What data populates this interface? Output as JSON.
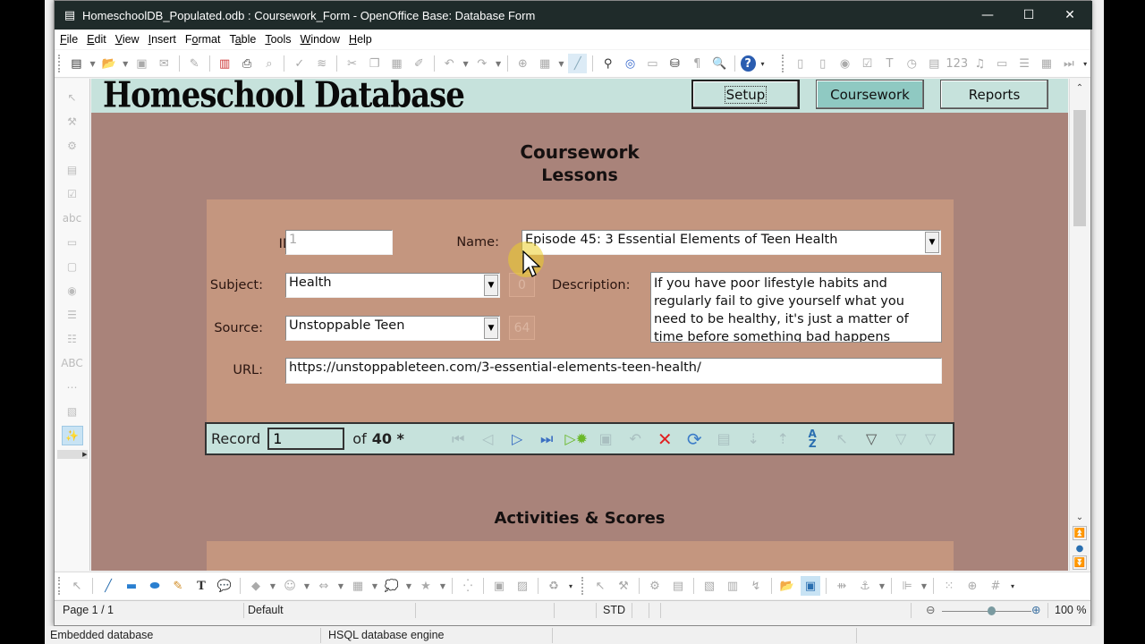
{
  "window": {
    "title": "HomeschoolDB_Populated.odb : Coursework_Form - OpenOffice Base: Database Form",
    "minimize": "—",
    "maximize": "☐",
    "close": "✕"
  },
  "menu": [
    {
      "label": "File",
      "key": "F"
    },
    {
      "label": "Edit",
      "key": "E"
    },
    {
      "label": "View",
      "key": "V"
    },
    {
      "label": "Insert",
      "key": "I"
    },
    {
      "label": "Format",
      "key": "o"
    },
    {
      "label": "Table",
      "key": "a"
    },
    {
      "label": "Tools",
      "key": "T"
    },
    {
      "label": "Window",
      "key": "W"
    },
    {
      "label": "Help",
      "key": "H"
    }
  ],
  "form": {
    "app_title": "Homeschool Database",
    "nav_buttons": [
      {
        "label": "Setup",
        "state": "focused"
      },
      {
        "label": "Coursework",
        "state": "selected"
      },
      {
        "label": "Reports",
        "state": "normal"
      }
    ],
    "section_title": "Coursework",
    "section_subtitle": "Lessons",
    "fields": {
      "id_label": "ID:",
      "id_value": "1",
      "name_label": "Name:",
      "name_value": "Episode 45: 3 Essential Elements of Teen Health",
      "subject_label": "Subject:",
      "subject_value": "Health",
      "subject_id": "0",
      "source_label": "Source:",
      "source_value": "Unstoppable Teen",
      "source_id": "64",
      "description_label": "Description:",
      "description_value": "If you have poor lifestyle habits and regularly fail to give yourself what you need to be healthy, it's just a matter of time before something bad happens",
      "url_label": "URL:",
      "url_value": "https://unstoppableteen.com/3-essential-elements-teen-health/"
    },
    "navigation": {
      "record_label": "Record",
      "record_value": "1",
      "of_label": "of",
      "total": "40 *"
    },
    "section2_title": "Activities & Scores"
  },
  "statusbar": {
    "page": "Page 1 / 1",
    "style": "Default",
    "mode": "STD",
    "zoom": "100 %",
    "zoom_level_percent": 100
  },
  "footer": {
    "left": "Embedded database",
    "right": "HSQL database engine"
  }
}
